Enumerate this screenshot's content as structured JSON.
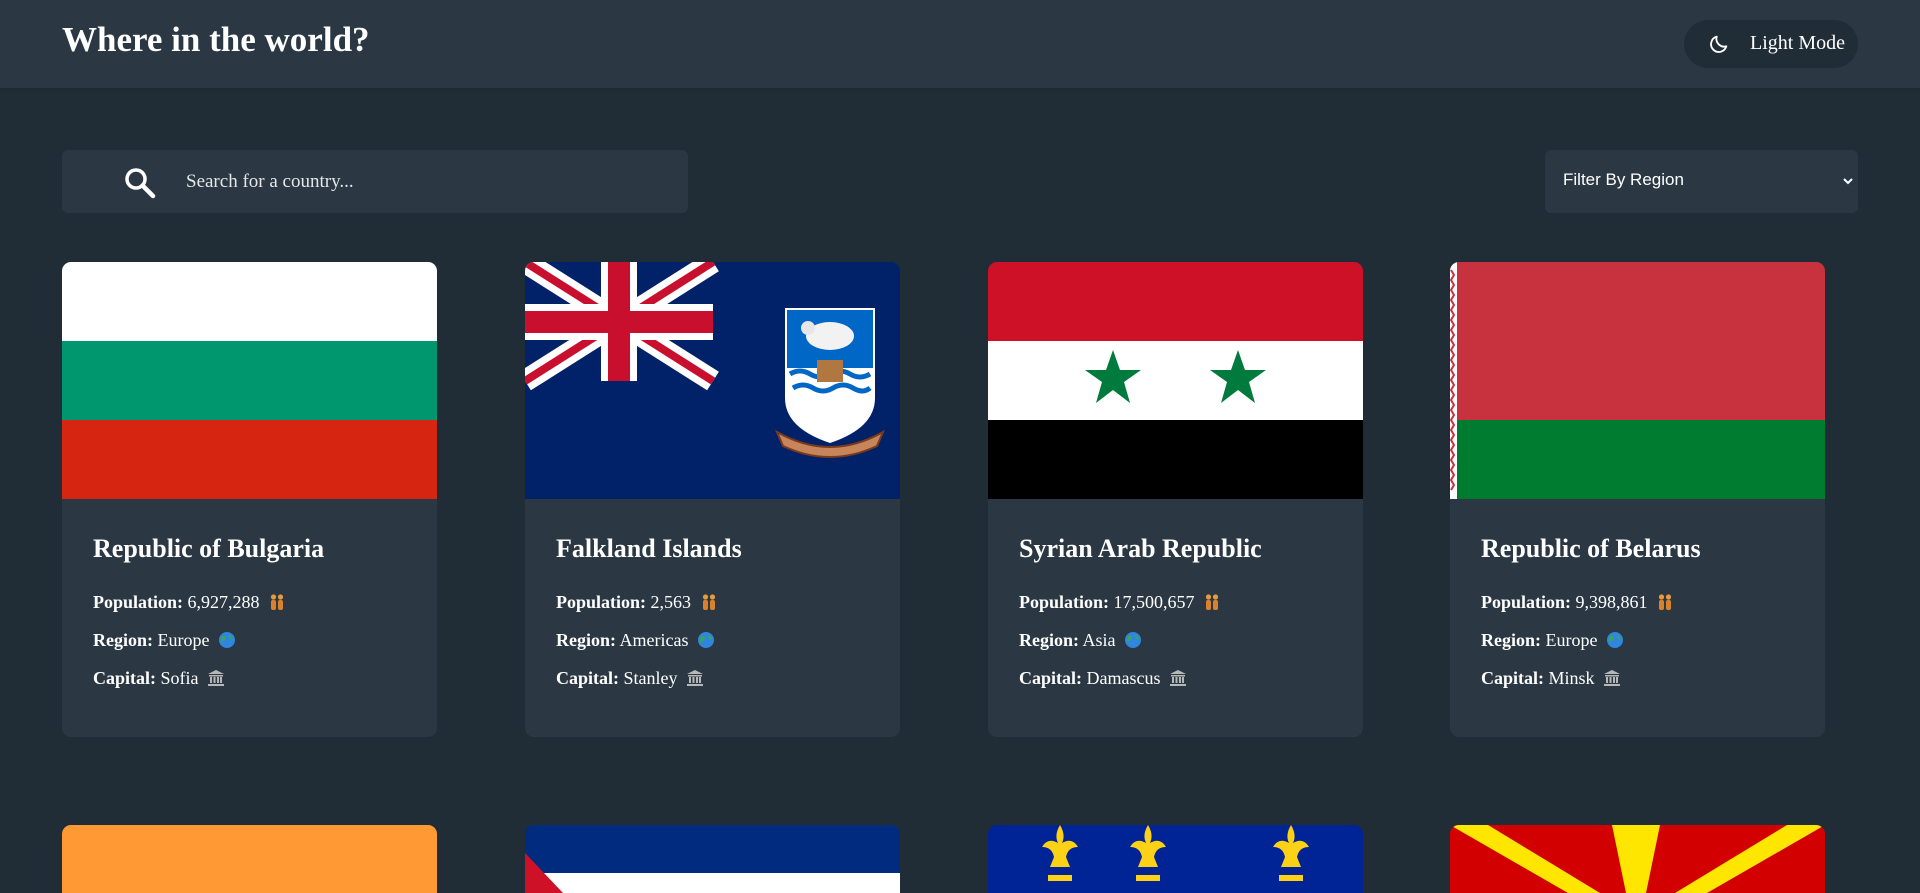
{
  "header": {
    "title": "Where in the world?",
    "mode_label": "Light Mode"
  },
  "search": {
    "placeholder": "Search for a country..."
  },
  "filter": {
    "label": "Filter By Region"
  },
  "labels": {
    "population": "Population:",
    "region": "Region:",
    "capital": "Capital:"
  },
  "countries": [
    {
      "name": "Republic of Bulgaria",
      "population": "6,927,288",
      "region": "Europe",
      "capital": "Sofia"
    },
    {
      "name": "Falkland Islands",
      "population": "2,563",
      "region": "Americas",
      "capital": "Stanley"
    },
    {
      "name": "Syrian Arab Republic",
      "population": "17,500,657",
      "region": "Asia",
      "capital": "Damascus"
    },
    {
      "name": "Republic of Belarus",
      "population": "9,398,861",
      "region": "Europe",
      "capital": "Minsk"
    }
  ],
  "colors": {
    "background": "#202c36",
    "surface": "#2b3844",
    "text": "#ffffff"
  },
  "icons": [
    "moon-icon",
    "search-icon",
    "chevron-down-icon",
    "people-icon",
    "globe-icon",
    "classical-building-icon"
  ]
}
